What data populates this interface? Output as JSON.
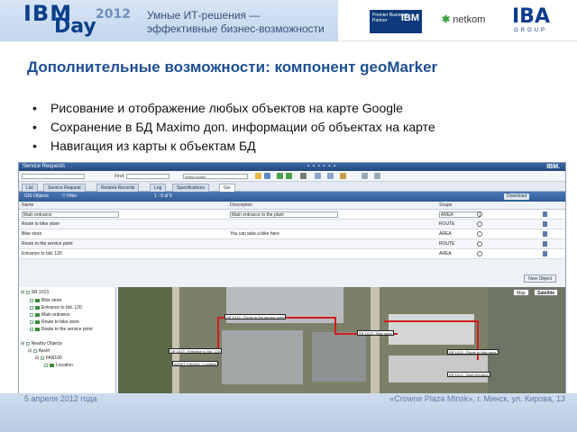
{
  "header": {
    "logo_ibm": "IBM",
    "logo_day": "Day",
    "logo_year": "2012",
    "tagline_line1": "Умные ИТ-решения —",
    "tagline_line2": "эффективные бизнес-возможности",
    "partner_logo_text": "Premier Business Partner",
    "partner_logo_mark": "IBM",
    "netkom_logo": "netkom",
    "iba_logo": "IBA",
    "iba_sub": "GROUP"
  },
  "slide": {
    "title": "Дополнительные возможности: компонент geoMarker",
    "bullets": [
      "Рисование и отображение любых объектов на карте Google",
      "Сохранение в БД Maximo  доп. информации об объектах на карте",
      "Навигация из карты к объектам БД"
    ]
  },
  "maximo": {
    "app_title": "Service Requests",
    "ibm_mark": "IBM.",
    "find_label": "Find:",
    "select_action": "Select Action",
    "tabs": [
      "List",
      "Service Request",
      "Related Records",
      "Log",
      "Specifications",
      "Gis"
    ],
    "active_tab": "Gis",
    "table_title": "GIS Objects",
    "filter_label": "Filter",
    "pagination": "1 - 5 of 5",
    "download_label": "Download",
    "columns": [
      "Name",
      "Description",
      "Shape"
    ],
    "rows": [
      {
        "name": "Main entrance",
        "description": "Main entrance to the plant",
        "shape": "AREA"
      },
      {
        "name": "Route to bike store",
        "description": "",
        "shape": "ROUTE"
      },
      {
        "name": "Bike store",
        "description": "You can take a bike here",
        "shape": "AREA"
      },
      {
        "name": "Route to the service point",
        "description": "",
        "shape": "ROUTE"
      },
      {
        "name": "Entrance to bld. 120",
        "description": "",
        "shape": "AREA"
      }
    ],
    "new_object_label": "New Object",
    "tree": {
      "root": "SR 1013",
      "children": [
        "Bike store",
        "Entrance to bld. 120",
        "Main entrance",
        "Route to bike store",
        "Route to the service point"
      ],
      "nearby": "Nearby Objects",
      "asset": "Asset",
      "asset_id": "FAN100",
      "location": "Location"
    },
    "map": {
      "map_button": "Map",
      "satellite_button": "Satellite",
      "active_view": "Satellite",
      "labels": [
        "SR 1013 - Route to the service point",
        "SR 1013 - Entrance to bld. 120",
        "ASSET FAN100 - Location",
        "SR 1013 - Bike store",
        "SR 1013 - Route to bike store",
        "SR 1013 - Main entrance"
      ]
    }
  },
  "footer": {
    "left": "5 апреля 2012 года",
    "right": "«Crowne Plaza Minsk», г. Минск, ул. Кирова, 13"
  },
  "colors": {
    "accent_blue": "#1d4f93",
    "route_red": "#d21c1c",
    "footer_bg": "#c3d4ea"
  }
}
